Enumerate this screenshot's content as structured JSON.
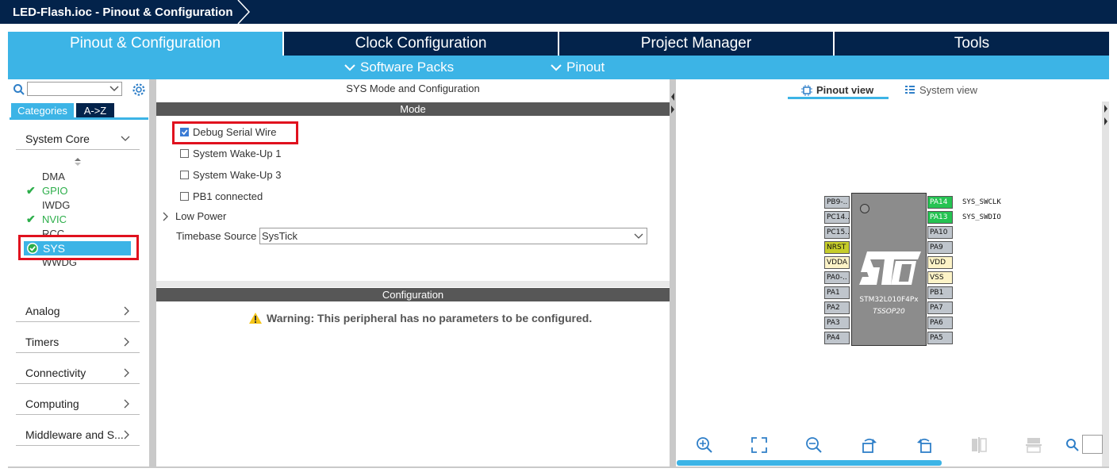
{
  "title": "LED-Flash.ioc - Pinout & Configuration",
  "main_tabs": [
    "Pinout & Configuration",
    "Clock Configuration",
    "Project Manager",
    "Tools"
  ],
  "sub_menu": [
    "Software Packs",
    "Pinout"
  ],
  "left": {
    "tabs": [
      "Categories",
      "A->Z"
    ],
    "categories": [
      "System Core",
      "Analog",
      "Timers",
      "Connectivity",
      "Computing",
      "Middleware and S..."
    ],
    "peripherals": [
      "DMA",
      "GPIO",
      "IWDG",
      "NVIC",
      "RCC",
      "SYS",
      "WWDG"
    ]
  },
  "middle": {
    "header": "SYS Mode and Configuration",
    "mode_label": "Mode",
    "options": [
      "Debug Serial Wire",
      "System Wake-Up 1",
      "System Wake-Up 3",
      "PB1 connected"
    ],
    "options_checked": [
      true,
      false,
      false,
      false
    ],
    "low_power": "Low Power",
    "timebase_label": "Timebase Source",
    "timebase_value": "SysTick",
    "config_label": "Configuration",
    "warning": "Warning: This peripheral has no parameters to be configured."
  },
  "right": {
    "view_tabs": [
      "Pinout view",
      "System view"
    ],
    "chip_name": "STM32L010F4Px",
    "package": "TSSOP20",
    "left_pins": [
      "PB9-..",
      "PC14..",
      "PC15..",
      "NRST",
      "VDDA",
      "PA0-..",
      "PA1",
      "PA2",
      "PA3",
      "PA4"
    ],
    "right_pins": [
      "PA14",
      "PA13",
      "PA10",
      "PA9",
      "VDD",
      "VSS",
      "PB1",
      "PA7",
      "PA6",
      "PA5"
    ],
    "signals": [
      "SYS_SWCLK",
      "SYS_SWDIO"
    ]
  },
  "colors": {
    "navy": "#03234b",
    "accent_blue": "#3cb4e6",
    "highlight_red": "#e0111e",
    "pin_green": "#25c352",
    "pin_yellow": "#c6cd2a",
    "pin_cream": "#fcf3c7",
    "pin_gray": "#bfc5cc"
  },
  "icons": [
    "search-icon",
    "gear-icon",
    "chevron-down-icon",
    "chevron-right-icon",
    "check-icon",
    "warning-icon",
    "zoom-in-icon",
    "fit-icon",
    "zoom-out-icon",
    "rotate-right-icon",
    "rotate-left-icon",
    "flip-vertical-icon",
    "flip-horizontal-icon",
    "search-icon"
  ]
}
